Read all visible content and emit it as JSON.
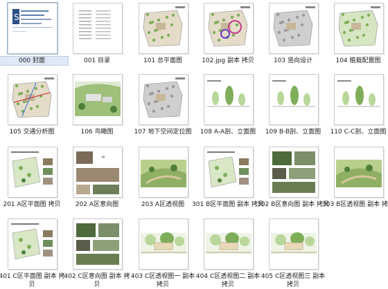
{
  "thumbnails": [
    {
      "label": "000 封面",
      "kind": "cover"
    },
    {
      "label": "001 目录",
      "kind": "toc"
    },
    {
      "label": "101 总平面图",
      "kind": "plan"
    },
    {
      "label": "102.jpg 副本 拷贝",
      "kind": "plan-color"
    },
    {
      "label": "103 竖向设计",
      "kind": "plan-gray"
    },
    {
      "label": "104 植栽配置图",
      "kind": "plan-green"
    },
    {
      "label": "105 交通分析图",
      "kind": "plan-traffic"
    },
    {
      "label": "106 鸟瞰图",
      "kind": "aerial"
    },
    {
      "label": "107 地下空间定位图",
      "kind": "plan-gray"
    },
    {
      "label": "108 A-A剖、立面图",
      "kind": "section"
    },
    {
      "label": "109 B-B剖、立面图",
      "kind": "section"
    },
    {
      "label": "110 C-C剖、立面图",
      "kind": "section"
    },
    {
      "label": "201 A区平面图 拷贝",
      "kind": "zone-plan"
    },
    {
      "label": "202 A区意向图",
      "kind": "intent"
    },
    {
      "label": "203 A区透视图",
      "kind": "perspective"
    },
    {
      "label": "301 B区平面图 副本 拷贝",
      "kind": "zone-plan"
    },
    {
      "label": "302 B区意向图 副本 拷贝",
      "kind": "intent-photo"
    },
    {
      "label": "303 B区透视图 副本 拷贝",
      "kind": "perspective"
    },
    {
      "label": "401 C区平面图 副本 拷贝",
      "kind": "zone-plan"
    },
    {
      "label": "402 C区意向图 副本 拷贝",
      "kind": "intent-photo"
    },
    {
      "label": "403 C区透视图一 副本 拷贝",
      "kind": "sketch"
    },
    {
      "label": "404 C区透视图二 副本 拷贝",
      "kind": "sketch"
    },
    {
      "label": "405 C区透视图三 副本 拷贝",
      "kind": "sketch"
    }
  ],
  "selected_index": 0
}
